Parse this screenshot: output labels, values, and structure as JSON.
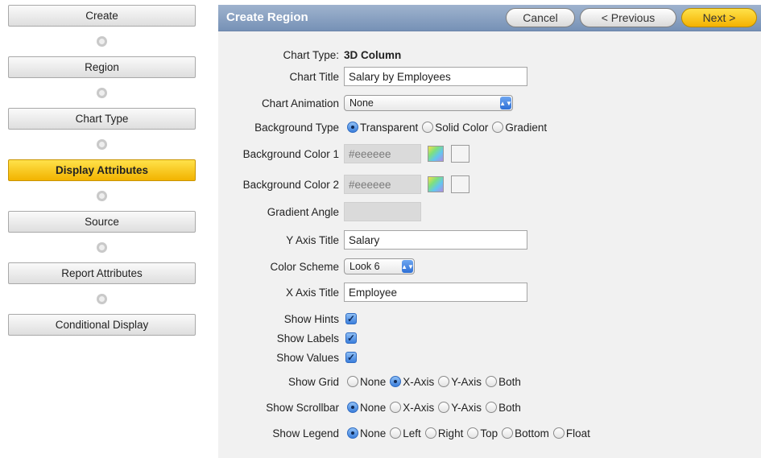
{
  "wizard": {
    "steps": [
      {
        "label": "Create"
      },
      {
        "label": "Region"
      },
      {
        "label": "Chart Type"
      },
      {
        "label": "Display Attributes",
        "active": true
      },
      {
        "label": "Source"
      },
      {
        "label": "Report Attributes"
      },
      {
        "label": "Conditional Display"
      }
    ]
  },
  "region": {
    "title": "Create Region",
    "buttons": {
      "cancel": "Cancel",
      "previous": "< Previous",
      "next": "Next >"
    }
  },
  "form": {
    "chart_type": {
      "label": "Chart Type:",
      "value": "3D Column"
    },
    "chart_title": {
      "label": "Chart Title",
      "value": "Salary by Employees"
    },
    "chart_animation": {
      "label": "Chart Animation",
      "value": "None"
    },
    "background_type": {
      "label": "Background Type",
      "options": [
        "Transparent",
        "Solid Color",
        "Gradient"
      ],
      "selected": "Transparent"
    },
    "background_color_1": {
      "label": "Background Color 1",
      "value": "#eeeeee"
    },
    "background_color_2": {
      "label": "Background Color 2",
      "value": "#eeeeee"
    },
    "gradient_angle": {
      "label": "Gradient Angle",
      "value": ""
    },
    "y_axis_title": {
      "label": "Y Axis Title",
      "value": "Salary"
    },
    "color_scheme": {
      "label": "Color Scheme",
      "value": "Look 6"
    },
    "x_axis_title": {
      "label": "X Axis Title",
      "value": "Employee"
    },
    "show_hints": {
      "label": "Show Hints",
      "checked": true
    },
    "show_labels": {
      "label": "Show Labels",
      "checked": true
    },
    "show_values": {
      "label": "Show Values",
      "checked": true
    },
    "show_grid": {
      "label": "Show Grid",
      "options": [
        "None",
        "X-Axis",
        "Y-Axis",
        "Both"
      ],
      "selected": "X-Axis"
    },
    "show_scrollbar": {
      "label": "Show Scrollbar",
      "options": [
        "None",
        "X-Axis",
        "Y-Axis",
        "Both"
      ],
      "selected": "None"
    },
    "show_legend": {
      "label": "Show Legend",
      "options": [
        "None",
        "Left",
        "Right",
        "Top",
        "Bottom",
        "Float"
      ],
      "selected": "None"
    }
  },
  "colors": {
    "header": "#8aa2c4",
    "accent": "#f2b300",
    "panel": "#f1f1f1"
  }
}
